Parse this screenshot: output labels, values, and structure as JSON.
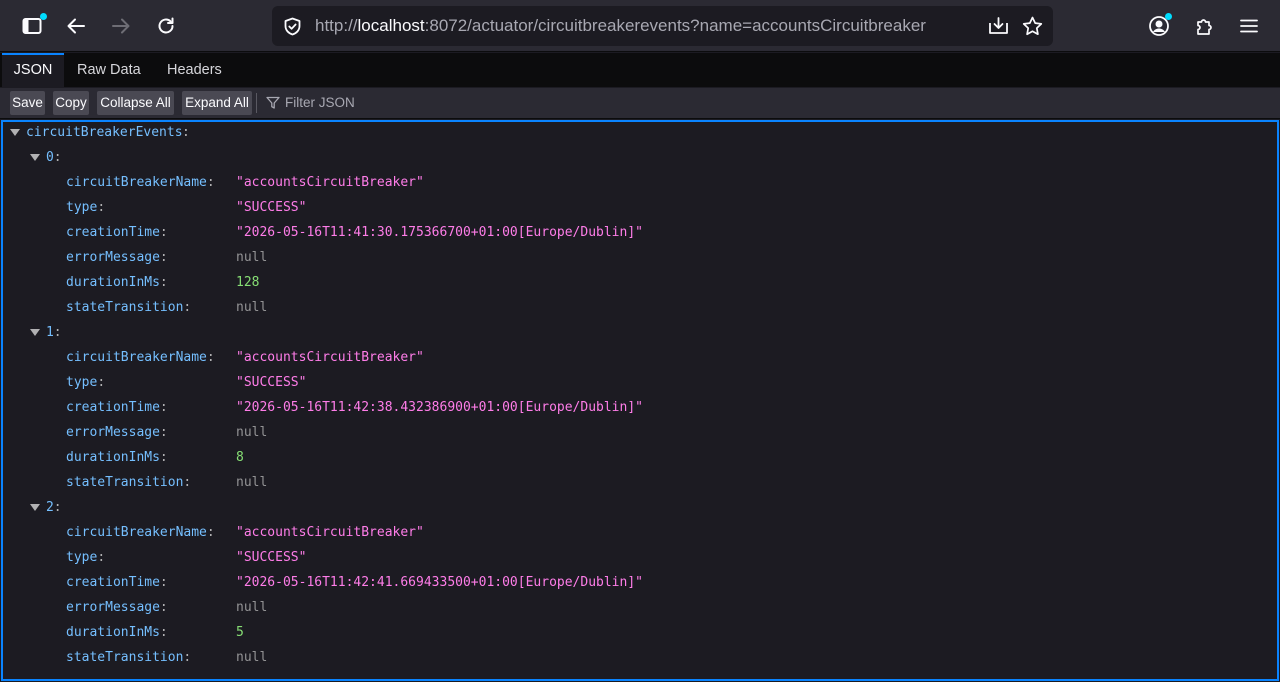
{
  "browser": {
    "url_prefix": "http://",
    "url_host": "localhost",
    "url_rest": ":8072/actuator/circuitbreakerevents?name=accountsCircuitbreaker"
  },
  "viewer": {
    "tabs": [
      "JSON",
      "Raw Data",
      "Headers"
    ],
    "buttons": {
      "save": "Save",
      "copy": "Copy",
      "collapse_all": "Collapse All",
      "expand_all": "Expand All"
    },
    "filter_placeholder": "Filter JSON"
  },
  "json": {
    "root_key": "circuitBreakerEvents",
    "events": [
      {
        "index": "0",
        "fields": [
          {
            "key": "circuitBreakerName",
            "value": "\"accountsCircuitBreaker\"",
            "kind": "str"
          },
          {
            "key": "type",
            "value": "\"SUCCESS\"",
            "kind": "str"
          },
          {
            "key": "creationTime",
            "value": "\"2026-05-16T11:41:30.175366700+01:00[Europe/Dublin]\"",
            "kind": "str"
          },
          {
            "key": "errorMessage",
            "value": "null",
            "kind": "nul"
          },
          {
            "key": "durationInMs",
            "value": "128",
            "kind": "num"
          },
          {
            "key": "stateTransition",
            "value": "null",
            "kind": "nul"
          }
        ]
      },
      {
        "index": "1",
        "fields": [
          {
            "key": "circuitBreakerName",
            "value": "\"accountsCircuitBreaker\"",
            "kind": "str"
          },
          {
            "key": "type",
            "value": "\"SUCCESS\"",
            "kind": "str"
          },
          {
            "key": "creationTime",
            "value": "\"2026-05-16T11:42:38.432386900+01:00[Europe/Dublin]\"",
            "kind": "str"
          },
          {
            "key": "errorMessage",
            "value": "null",
            "kind": "nul"
          },
          {
            "key": "durationInMs",
            "value": "8",
            "kind": "num"
          },
          {
            "key": "stateTransition",
            "value": "null",
            "kind": "nul"
          }
        ]
      },
      {
        "index": "2",
        "fields": [
          {
            "key": "circuitBreakerName",
            "value": "\"accountsCircuitBreaker\"",
            "kind": "str"
          },
          {
            "key": "type",
            "value": "\"SUCCESS\"",
            "kind": "str"
          },
          {
            "key": "creationTime",
            "value": "\"2026-05-16T11:42:41.669433500+01:00[Europe/Dublin]\"",
            "kind": "str"
          },
          {
            "key": "errorMessage",
            "value": "null",
            "kind": "nul"
          },
          {
            "key": "durationInMs",
            "value": "5",
            "kind": "num"
          },
          {
            "key": "stateTransition",
            "value": "null",
            "kind": "nul"
          }
        ]
      }
    ]
  },
  "colors": {
    "accent": "#0a84ff",
    "key": "#75bfff",
    "string": "#ff7de9",
    "number": "#86de74",
    "null": "#939395"
  }
}
